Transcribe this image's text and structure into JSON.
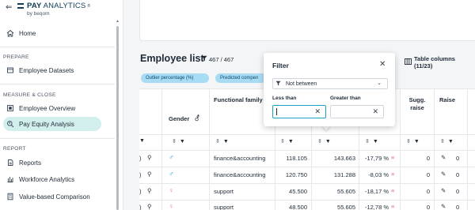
{
  "brand": {
    "name_bold": "PAY",
    "name_light": "ANALYTICS",
    "tm": "®",
    "by": "by beqom"
  },
  "sidebar": {
    "home": "Home",
    "sections": [
      {
        "label": "PREPARE",
        "items": [
          {
            "label": "Employee Datasets",
            "icon": "dataset-icon"
          }
        ]
      },
      {
        "label": "MEASURE & CLOSE",
        "items": [
          {
            "label": "Employee Overview",
            "icon": "overview-icon"
          },
          {
            "label": "Pay Equity Analysis",
            "icon": "search-people-icon",
            "active": true
          }
        ]
      },
      {
        "label": "REPORT",
        "items": [
          {
            "label": "Reports",
            "icon": "reports-icon"
          },
          {
            "label": "Workforce Analytics",
            "icon": "analytics-icon"
          },
          {
            "label": "Value-based Comparison",
            "icon": "calculator-icon"
          }
        ]
      }
    ]
  },
  "main": {
    "title": "Employee list",
    "count": "467 / 467",
    "table_columns": "Table columns (11/23)",
    "chips": [
      "Outlier percentage (%)",
      "Predicted compen"
    ]
  },
  "table": {
    "headers": {
      "gender": "Gender",
      "functional_family": "Functional family",
      "sugg_raise": "Sugg. raise",
      "raise": "Raise"
    },
    "rows": [
      {
        "gender": "male",
        "family": "finance&accounting",
        "v1": "118.105",
        "v2": "143.663",
        "pct": "-17,79 %",
        "sugg": "0",
        "raise": "0"
      },
      {
        "gender": "male",
        "family": "finance&accounting",
        "v1": "120.750",
        "v2": "131.288",
        "pct": "-8,03 %",
        "sugg": "0",
        "raise": "0"
      },
      {
        "gender": "female",
        "family": "support",
        "v1": "45.500",
        "v2": "55.605",
        "pct": "-18,17 %",
        "sugg": "0",
        "raise": "0"
      },
      {
        "gender": "female",
        "family": "support",
        "v1": "48.500",
        "v2": "55.605",
        "pct": "-12,78 %",
        "sugg": "0",
        "raise": "0"
      }
    ]
  },
  "filter_popup": {
    "title": "Filter",
    "operator": "Not between",
    "less_than_label": "Less than",
    "greater_than_label": "Greater than",
    "less_than_value": "",
    "greater_than_value": ""
  },
  "colors": {
    "accent": "#1aa2c2",
    "active_nav": "#d2efed",
    "chip": "#a8dcf5",
    "male": "#1aa2c2",
    "female": "#e6738f",
    "outlier_mark": "#e6738f"
  }
}
